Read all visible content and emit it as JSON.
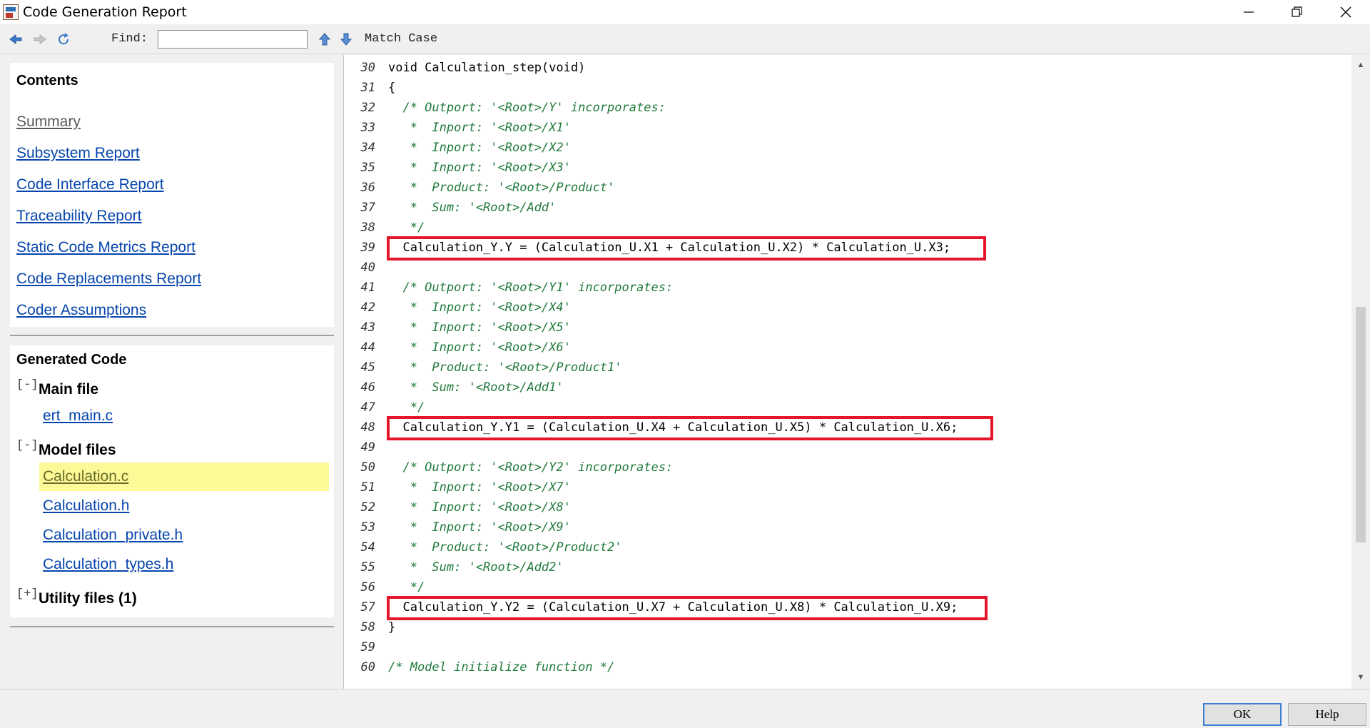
{
  "window": {
    "title": "Code Generation Report",
    "icons": {
      "app": "matlab-report-icon",
      "minimize": "minimize-icon",
      "maximize": "restore-icon",
      "close": "close-icon"
    }
  },
  "toolbar": {
    "icons": [
      "back-arrow-icon",
      "forward-arrow-icon",
      "refresh-icon",
      "find-previous-icon",
      "find-next-icon"
    ],
    "find_label": "Find:",
    "find_value": "",
    "match_case_label": "Match Case"
  },
  "contents": {
    "title": "Contents",
    "links": [
      {
        "label": "Summary",
        "visited": true
      },
      {
        "label": "Subsystem Report"
      },
      {
        "label": "Code Interface Report"
      },
      {
        "label": "Traceability Report"
      },
      {
        "label": "Static Code Metrics Report"
      },
      {
        "label": "Code Replacements Report"
      },
      {
        "label": "Coder Assumptions"
      }
    ]
  },
  "generated_code": {
    "title": "Generated Code",
    "main_file": {
      "toggle": "[-]",
      "label": "Main file",
      "files": [
        "ert_main.c"
      ]
    },
    "model_files": {
      "toggle": "[-]",
      "label": "Model files",
      "files": [
        "Calculation.c",
        "Calculation.h",
        "Calculation_private.h",
        "Calculation_types.h"
      ],
      "active": "Calculation.c"
    },
    "utility_files": {
      "toggle": "[+]",
      "label": "Utility files (1)"
    }
  },
  "code": {
    "lines": [
      {
        "n": "30",
        "text": "void Calculation_step(void)",
        "type": "code"
      },
      {
        "n": "31",
        "text": "{",
        "type": "code"
      },
      {
        "n": "32",
        "text": "  /* Outport: '<Root>/Y' incorporates:",
        "type": "comment"
      },
      {
        "n": "33",
        "text": "   *  Inport: '<Root>/X1'",
        "type": "comment"
      },
      {
        "n": "34",
        "text": "   *  Inport: '<Root>/X2'",
        "type": "comment"
      },
      {
        "n": "35",
        "text": "   *  Inport: '<Root>/X3'",
        "type": "comment"
      },
      {
        "n": "36",
        "text": "   *  Product: '<Root>/Product'",
        "type": "comment"
      },
      {
        "n": "37",
        "text": "   *  Sum: '<Root>/Add'",
        "type": "comment"
      },
      {
        "n": "38",
        "text": "   */",
        "type": "comment"
      },
      {
        "n": "39",
        "text": "  Calculation_Y.Y = (Calculation_U.X1 + Calculation_U.X2) * Calculation_U.X3;",
        "type": "code"
      },
      {
        "n": "40",
        "text": "",
        "type": "code"
      },
      {
        "n": "41",
        "text": "  /* Outport: '<Root>/Y1' incorporates:",
        "type": "comment"
      },
      {
        "n": "42",
        "text": "   *  Inport: '<Root>/X4'",
        "type": "comment"
      },
      {
        "n": "43",
        "text": "   *  Inport: '<Root>/X5'",
        "type": "comment"
      },
      {
        "n": "44",
        "text": "   *  Inport: '<Root>/X6'",
        "type": "comment"
      },
      {
        "n": "45",
        "text": "   *  Product: '<Root>/Product1'",
        "type": "comment"
      },
      {
        "n": "46",
        "text": "   *  Sum: '<Root>/Add1'",
        "type": "comment"
      },
      {
        "n": "47",
        "text": "   */",
        "type": "comment"
      },
      {
        "n": "48",
        "text": "  Calculation_Y.Y1 = (Calculation_U.X4 + Calculation_U.X5) * Calculation_U.X6;",
        "type": "code"
      },
      {
        "n": "49",
        "text": "",
        "type": "code"
      },
      {
        "n": "50",
        "text": "  /* Outport: '<Root>/Y2' incorporates:",
        "type": "comment"
      },
      {
        "n": "51",
        "text": "   *  Inport: '<Root>/X7'",
        "type": "comment"
      },
      {
        "n": "52",
        "text": "   *  Inport: '<Root>/X8'",
        "type": "comment"
      },
      {
        "n": "53",
        "text": "   *  Inport: '<Root>/X9'",
        "type": "comment"
      },
      {
        "n": "54",
        "text": "   *  Product: '<Root>/Product2'",
        "type": "comment"
      },
      {
        "n": "55",
        "text": "   *  Sum: '<Root>/Add2'",
        "type": "comment"
      },
      {
        "n": "56",
        "text": "   */",
        "type": "comment"
      },
      {
        "n": "57",
        "text": "  Calculation_Y.Y2 = (Calculation_U.X7 + Calculation_U.X8) * Calculation_U.X9;",
        "type": "code"
      },
      {
        "n": "58",
        "text": "}",
        "type": "code"
      },
      {
        "n": "59",
        "text": "",
        "type": "code"
      },
      {
        "n": "60",
        "text": "/* Model initialize function */",
        "type": "comment"
      }
    ],
    "highlighted_lines": [
      "39",
      "48",
      "57"
    ],
    "highlight_color": "#e5162a"
  },
  "buttons": {
    "ok": "OK",
    "help": "Help"
  }
}
